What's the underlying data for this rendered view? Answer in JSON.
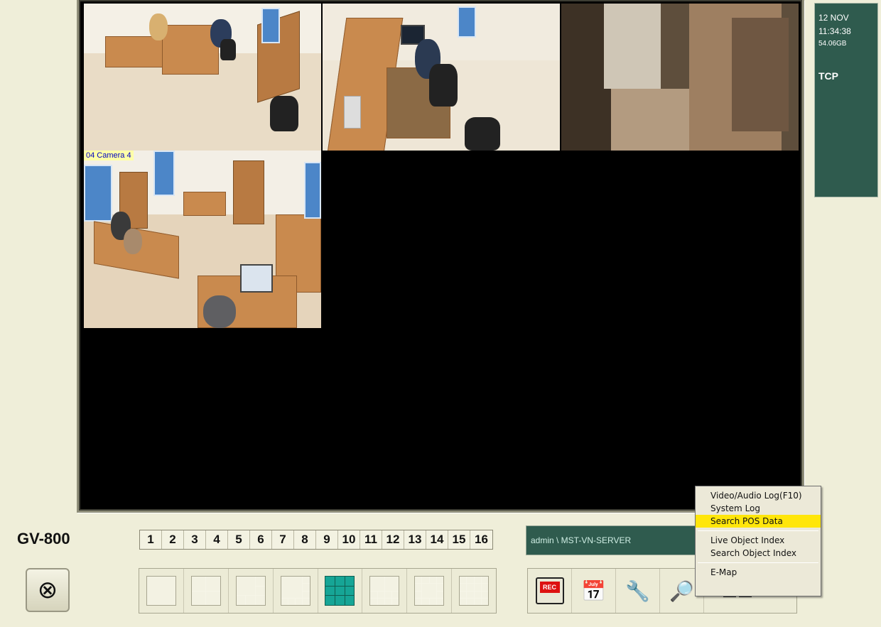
{
  "app": {
    "brand": "GV-800",
    "exit_icon": "power-cross-icon"
  },
  "cameras": [
    {
      "id": "cam1",
      "label": ""
    },
    {
      "id": "cam2",
      "label": ""
    },
    {
      "id": "cam3",
      "label": ""
    },
    {
      "id": "cam4",
      "label": "04 Camera 4"
    }
  ],
  "status": {
    "date": "12 NOV",
    "time": "11:34:38",
    "disk": "54.06GB",
    "protocol": "TCP"
  },
  "camera_numbers": [
    "1",
    "2",
    "3",
    "4",
    "5",
    "6",
    "7",
    "8",
    "9",
    "10",
    "11",
    "12",
    "13",
    "14",
    "15",
    "16"
  ],
  "host": "admin \\ MST-VN-SERVER",
  "layouts": [
    {
      "name": "single",
      "active": false
    },
    {
      "name": "quad",
      "active": false
    },
    {
      "name": "six",
      "active": false
    },
    {
      "name": "eight",
      "active": false
    },
    {
      "name": "nine",
      "active": true
    },
    {
      "name": "ten",
      "active": false
    },
    {
      "name": "thirteen",
      "active": false
    },
    {
      "name": "sixteen",
      "active": false
    }
  ],
  "tools": [
    {
      "name": "rec-icon",
      "label": "REC"
    },
    {
      "name": "schedule-icon"
    },
    {
      "name": "configure-icon"
    },
    {
      "name": "search-log-icon"
    },
    {
      "name": "network-icon"
    }
  ],
  "context_menu": {
    "group1": [
      "Video/Audio Log(F10)",
      "System Log",
      "Search POS Data"
    ],
    "group2": [
      "Live Object Index",
      "Search Object Index"
    ],
    "group3": [
      "E-Map"
    ],
    "highlighted": "Search POS Data"
  }
}
